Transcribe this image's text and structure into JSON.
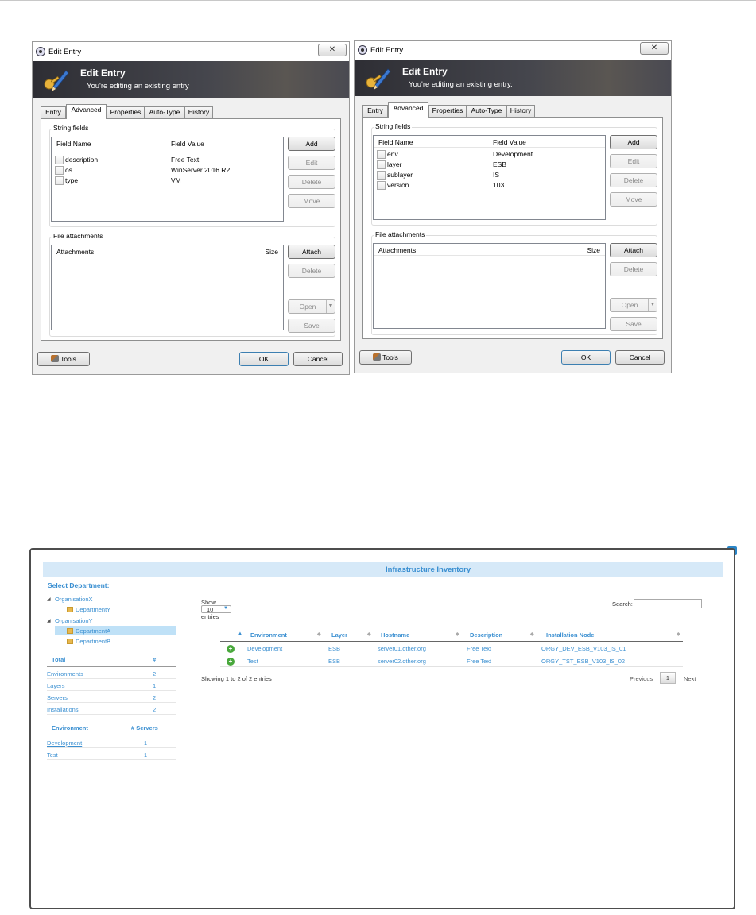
{
  "windows": [
    {
      "title": "Edit Entry",
      "close_label": "✕",
      "banner_title": "Edit Entry",
      "banner_subtitle": "You're editing an existing entry",
      "tabs": [
        "Entry",
        "Advanced",
        "Properties",
        "Auto-Type",
        "History"
      ],
      "active_tab": "Advanced",
      "string_fields_label": "String fields",
      "columns": {
        "name": "Field Name",
        "value": "Field Value"
      },
      "rows": [
        {
          "name": "description",
          "value": "Free Text"
        },
        {
          "name": "os",
          "value": "WinServer 2016 R2"
        },
        {
          "name": "type",
          "value": "VM"
        }
      ],
      "field_buttons": {
        "add": "Add",
        "edit": "Edit",
        "delete": "Delete",
        "move": "Move"
      },
      "attachments_label": "File attachments",
      "attach_columns": {
        "name": "Attachments",
        "size": "Size"
      },
      "attach_buttons": {
        "attach": "Attach",
        "delete": "Delete",
        "open": "Open",
        "save": "Save"
      },
      "footer": {
        "tools": "Tools",
        "ok": "OK",
        "cancel": "Cancel"
      }
    },
    {
      "title": "Edit Entry",
      "close_label": "✕",
      "banner_title": "Edit Entry",
      "banner_subtitle": "You're editing an existing entry.",
      "tabs": [
        "Entry",
        "Advanced",
        "Properties",
        "Auto-Type",
        "History"
      ],
      "active_tab": "Advanced",
      "string_fields_label": "String fields",
      "columns": {
        "name": "Field Name",
        "value": "Field Value"
      },
      "rows": [
        {
          "name": "env",
          "value": "Development"
        },
        {
          "name": "layer",
          "value": "ESB"
        },
        {
          "name": "sublayer",
          "value": "IS"
        },
        {
          "name": "version",
          "value": "103"
        }
      ],
      "field_buttons": {
        "add": "Add",
        "edit": "Edit",
        "delete": "Delete",
        "move": "Move"
      },
      "attachments_label": "File attachments",
      "attach_columns": {
        "name": "Attachments",
        "size": "Size"
      },
      "attach_buttons": {
        "attach": "Attach",
        "delete": "Delete",
        "open": "Open",
        "save": "Save"
      },
      "footer": {
        "tools": "Tools",
        "ok": "OK",
        "cancel": "Cancel"
      }
    }
  ],
  "inventory": {
    "close_label": "x",
    "header": "Infrastructure Inventory",
    "select_department": "Select Department:",
    "tree": [
      {
        "label": "OrganisationX",
        "children": [
          "DepartmentY"
        ]
      },
      {
        "label": "OrganisationY",
        "children": [
          "DepartmentA",
          "DepartmentB"
        ]
      }
    ],
    "selected_department": "DepartmentA",
    "totals": {
      "header": {
        "label": "Total",
        "count": "#"
      },
      "rows": [
        {
          "label": "Environments",
          "count": "2"
        },
        {
          "label": "Layers",
          "count": "1"
        },
        {
          "label": "Servers",
          "count": "2"
        },
        {
          "label": "Installations",
          "count": "2"
        }
      ]
    },
    "env_servers": {
      "header": {
        "label": "Environment",
        "count": "# Servers"
      },
      "rows": [
        {
          "label": "Development",
          "count": "1"
        },
        {
          "label": "Test",
          "count": "1"
        }
      ]
    },
    "show_label": "Show",
    "entries_value": "10",
    "entries_label": "entries",
    "search_label": "Search:",
    "table": {
      "headers": [
        "Environment",
        "Layer",
        "Hostname",
        "Description",
        "Installation Node"
      ],
      "rows": [
        [
          "Development",
          "ESB",
          "server01.other.org",
          "Free Text",
          "ORGY_DEV_ESB_V103_IS_01"
        ],
        [
          "Test",
          "ESB",
          "server02.other.org",
          "Free Text",
          "ORGY_TST_ESB_V103_IS_02"
        ]
      ]
    },
    "info": "Showing 1 to 2 of 2 entries",
    "pager": {
      "previous": "Previous",
      "page": "1",
      "next": "Next"
    }
  }
}
